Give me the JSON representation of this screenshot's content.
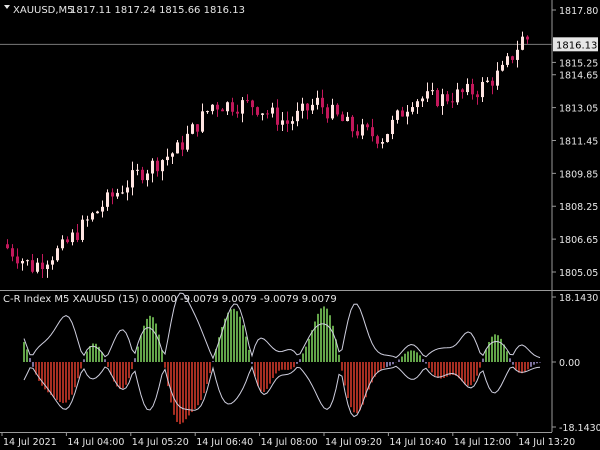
{
  "main_panel": {
    "header": {
      "symbol_label": "XAUUSD,M5",
      "ohlc_label": "1817.11 1817.24 1815.66 1816.13"
    },
    "current_price_label": "1816.13",
    "current_price": 1816.13,
    "price_ticks": [
      {
        "value": 1817.8,
        "label": "1817.80"
      },
      {
        "value": 1815.25,
        "label": "1815.25"
      },
      {
        "value": 1814.65,
        "label": "1814.65"
      },
      {
        "value": 1813.05,
        "label": "1813.05"
      },
      {
        "value": 1811.45,
        "label": "1811.45"
      },
      {
        "value": 1809.85,
        "label": "1809.85"
      },
      {
        "value": 1808.25,
        "label": "1808.25"
      },
      {
        "value": 1806.65,
        "label": "1806.65"
      },
      {
        "value": 1805.05,
        "label": "1805.05"
      }
    ]
  },
  "indicator_panel": {
    "header_label": "C-R Index M5  XAUUSD  (15) 0.0000 -9.0079 9.0079 -9.0079 9.0079",
    "ticks": [
      {
        "value": 18.143,
        "label": "18.1430"
      },
      {
        "value": 0,
        "label": "0.00"
      },
      {
        "value": -18.143,
        "label": "-18.1430"
      }
    ]
  },
  "time_axis": {
    "labels": [
      "14 Jul 2021",
      "14 Jul 04:00",
      "14 Jul 05:20",
      "14 Jul 06:40",
      "14 Jul 08:00",
      "14 Jul 09:20",
      "14 Jul 10:40",
      "14 Jul 12:00",
      "14 Jul 13:20"
    ]
  },
  "colors": {
    "background": "#000000",
    "bull_candle": "#ffe4e1",
    "bear_candle": "#c2185b",
    "hist_positive": "#7ccd5c",
    "hist_negative": "#d03a2a",
    "hist_neutral": "#9b8fc7",
    "envelope_line": "#cfcfdf",
    "text": "#e6e6e6",
    "separator": "#9a9a9a"
  }
}
